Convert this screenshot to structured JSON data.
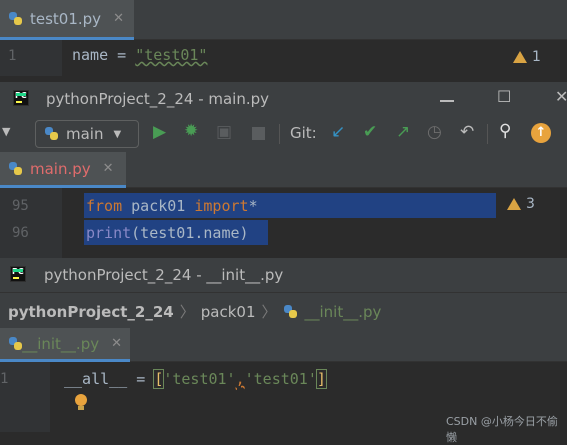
{
  "window1": {
    "tab": {
      "label": "test01.py",
      "close": "✕"
    },
    "line_number": "1",
    "code": {
      "var": "name",
      "op": " = ",
      "string": "\"test01\""
    },
    "warning_count": "1"
  },
  "window2": {
    "title": "pythonProject_2_24 - main.py",
    "controls": {
      "maximize": "☐",
      "close": "✕"
    },
    "branch": "main",
    "git_label": "Git:",
    "tab": {
      "label": "main.py",
      "close": "✕"
    },
    "lines": [
      {
        "num": "95",
        "kw1": "from",
        "mod": " pack01 ",
        "kw2": "import",
        "rest": "*"
      },
      {
        "num": "96",
        "fn": "print",
        "rest": "(test01.name)"
      }
    ],
    "warning_count": "3",
    "colors": {
      "selection": "#214283",
      "run": "#499c54",
      "update": "#e8a33d"
    }
  },
  "window3": {
    "title": "pythonProject_2_24 - __init__.py",
    "breadcrumb": [
      "pythonProject_2_24",
      "pack01",
      "__init__.py"
    ],
    "tab": {
      "label": "__init__.py",
      "close": "✕"
    },
    "line_number": "1",
    "code": {
      "name": "__all__",
      "op": " = ",
      "open": "[",
      "s1": "'test01'",
      "comma": ",",
      "s2": "'test01'",
      "close": "]"
    }
  },
  "watermark": "CSDN @小杨今日不偷懒"
}
